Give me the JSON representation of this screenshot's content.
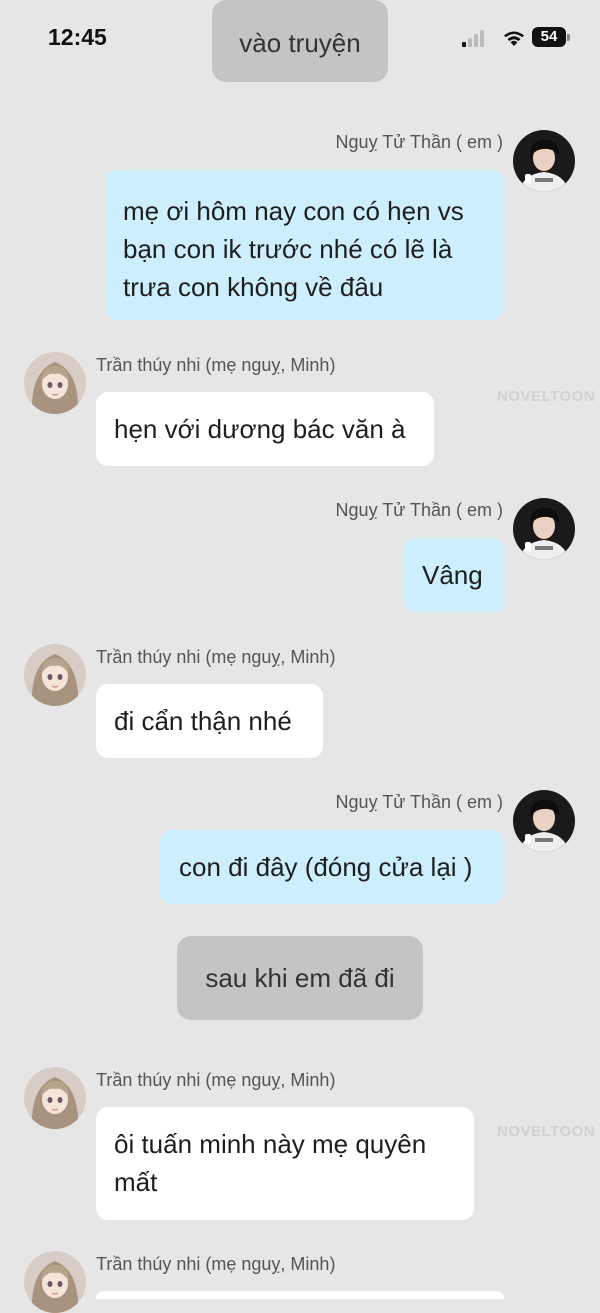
{
  "status_bar": {
    "time": "12:45",
    "battery": "54"
  },
  "watermark": "NOVELTOON",
  "messages": [
    {
      "kind": "narration",
      "text": "vào truyện"
    },
    {
      "kind": "outgoing",
      "sender": "Nguỵ Tử Thần ( em )",
      "text": "mẹ ơi hôm nay con có hẹn vs bạn con ik trước nhé có lẽ là trưa con không về đâu"
    },
    {
      "kind": "incoming",
      "sender": "Trần thúy nhi (mẹ nguỵ, Minh)",
      "text": "hẹn với dương bác văn à"
    },
    {
      "kind": "outgoing",
      "sender": "Nguỵ Tử Thần ( em )",
      "text": "Vâng"
    },
    {
      "kind": "incoming",
      "sender": "Trần thúy nhi (mẹ nguỵ, Minh)",
      "text": "đi cẩn thận nhé"
    },
    {
      "kind": "outgoing",
      "sender": "Nguỵ Tử Thần ( em )",
      "text": "con đi đây (đóng cửa lại )"
    },
    {
      "kind": "narration",
      "text": "sau khi em đã đi"
    },
    {
      "kind": "incoming",
      "sender": "Trần thúy nhi (mẹ nguỵ, Minh)",
      "text": "ôi tuấn minh này mẹ quyên mất"
    },
    {
      "kind": "incoming",
      "sender": "Trần thúy nhi (mẹ nguỵ, Minh)",
      "text": ""
    }
  ]
}
